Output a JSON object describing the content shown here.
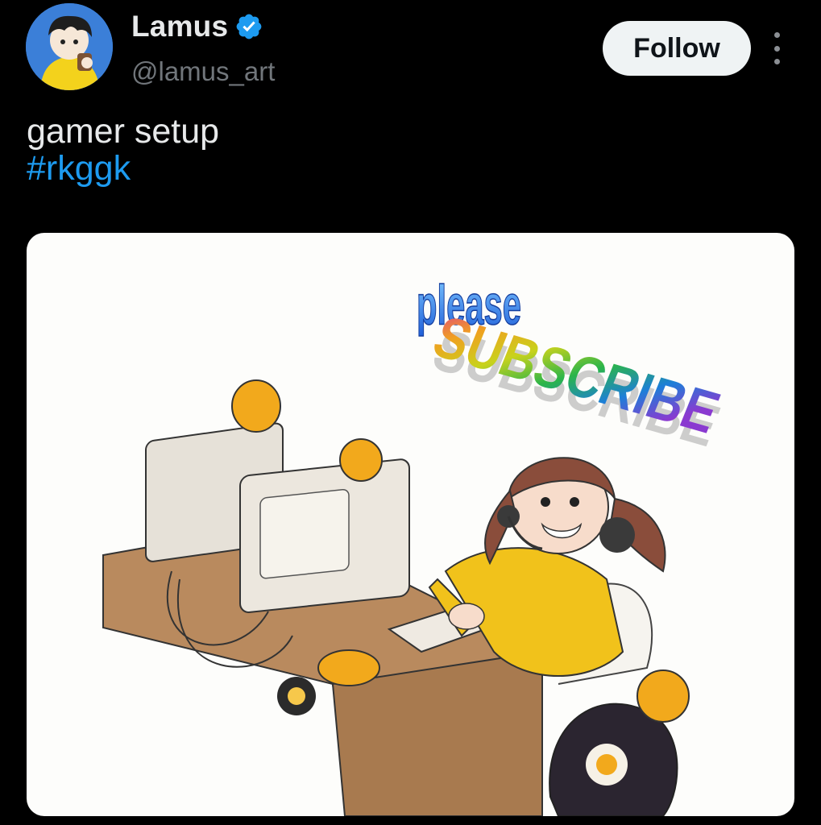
{
  "author": {
    "name": "Lamus",
    "handle": "@lamus_art",
    "verified": true,
    "avatar_icon": "avatar-character-yellow-hoodie"
  },
  "actions": {
    "follow_label": "Follow",
    "more_icon": "vertical-ellipsis-icon"
  },
  "tweet": {
    "text_line": "gamer setup",
    "hashtag": "#rkggk"
  },
  "media": {
    "please_text": "please",
    "subscribe_text": "SUBSCRIBE"
  },
  "colors": {
    "background": "#000000",
    "text": "#e7e9ea",
    "secondary_text": "#71767b",
    "link": "#1d9bf0",
    "verified": "#1d9bf0",
    "follow_bg": "#eff3f4"
  }
}
